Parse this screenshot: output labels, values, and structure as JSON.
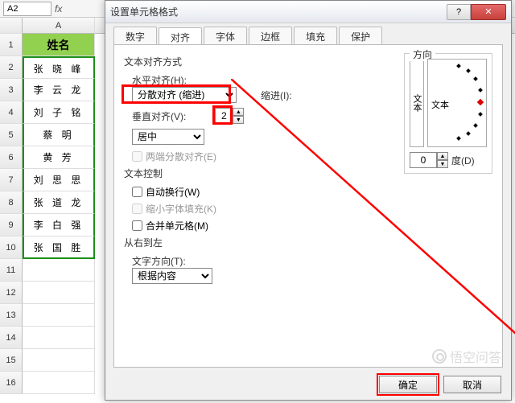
{
  "sheet": {
    "name_box": "A2",
    "col_labels": [
      "A"
    ],
    "header_cell": "姓名",
    "names": [
      "张 晓 峰",
      "李 云 龙",
      "刘 子 铭",
      "蔡    明",
      "黄    芳",
      "刘 思 思",
      "张 道 龙",
      "李 白 强",
      "张 国 胜"
    ],
    "blank_rows": [
      "11",
      "12",
      "13",
      "14",
      "15",
      "16"
    ]
  },
  "dialog": {
    "title": "设置单元格格式",
    "tabs": [
      "数字",
      "对齐",
      "字体",
      "边框",
      "填充",
      "保护"
    ],
    "active_tab": "对齐",
    "section_align": "文本对齐方式",
    "h_align_label": "水平对齐(H):",
    "h_align_value": "分散对齐 (缩进)",
    "indent_label": "缩进(I):",
    "indent_value": "2",
    "v_align_label": "垂直对齐(V):",
    "v_align_value": "居中",
    "justify_distributed": "两端分散对齐(E)",
    "section_control": "文本控制",
    "wrap": "自动换行(W)",
    "shrink": "缩小字体填充(K)",
    "merge": "合并单元格(M)",
    "section_rtl": "从右到左",
    "text_dir_label": "文字方向(T):",
    "text_dir_value": "根据内容",
    "orient_label": "方向",
    "orient_vert_text": "文本",
    "orient_horiz_text": "文本",
    "degree_value": "0",
    "degree_label": "度(D)",
    "ok": "确定",
    "cancel": "取消"
  },
  "watermark": "悟空问答"
}
